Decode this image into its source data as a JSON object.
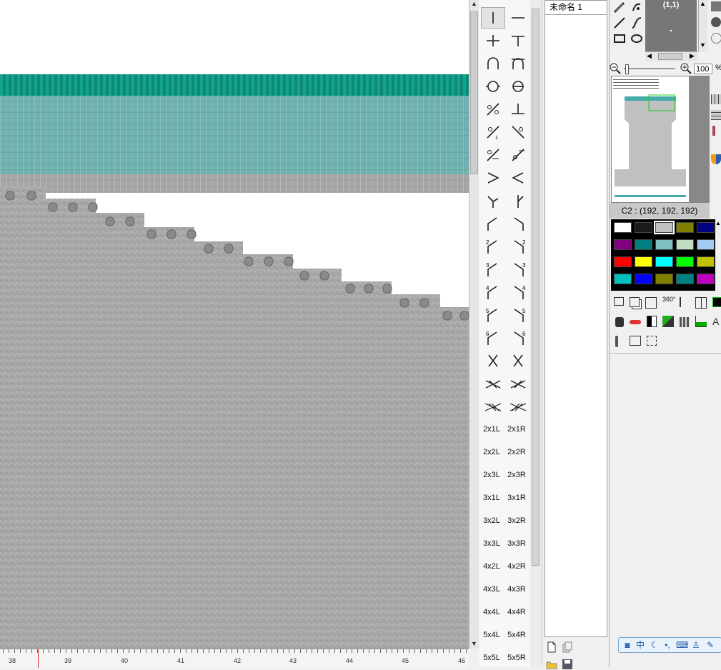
{
  "document": {
    "tab_title": "未命名 1"
  },
  "canvas": {
    "ruler": {
      "labels": [
        "38",
        "39",
        "40",
        "41",
        "42",
        "43",
        "44",
        "45",
        "46"
      ]
    }
  },
  "palette": {
    "symbols": [
      "vertical-line",
      "horizontal-line",
      "plus",
      "t-shape",
      "arch-open",
      "arch-closed",
      "circle-horizontal",
      "circle-vertical",
      "slash-circles",
      "inverted-t",
      "transfer-left",
      "transfer-right",
      "cross-left",
      "cross-right",
      "chevron-right",
      "chevron-left",
      "y-left",
      "y-right",
      "bend-left",
      "bend-right",
      "bend-left-2",
      "bend-right-2",
      "bend-left-3",
      "bend-right-3",
      "bend-left-4",
      "bend-right-4",
      "bend-left-5",
      "bend-right-5",
      "bend-left-6",
      "bend-right-6",
      "x-cross",
      "x-cross-mirror",
      "double-cross",
      "double-cross-mirror",
      "triple-cross",
      "triple-cross-mirror"
    ],
    "text_items": [
      "2x1L",
      "2x1R",
      "2x2L",
      "2x2R",
      "2x3L",
      "2x3R",
      "3x1L",
      "3x1R",
      "3x2L",
      "3x2R",
      "3x3L",
      "3x3R",
      "4x2L",
      "4x2R",
      "4x3L",
      "4x3R",
      "4x4L",
      "4x4R",
      "5x4L",
      "5x4R",
      "5x5L",
      "5x5R"
    ]
  },
  "navigator": {
    "coordinate": "(1,1)",
    "zoom_value": "100",
    "zoom_unit": "%"
  },
  "color": {
    "label": "C2 : (192, 192, 192)",
    "swatches": [
      "#ffffff",
      "#1a1a1a",
      "#c0c0c0",
      "#808000",
      "#000080",
      "#800080",
      "#008080",
      "#7fbfbf",
      "#c0dcc0",
      "#a6caf0",
      "#ff0000",
      "#ffff00",
      "#00ffff",
      "#00ff00",
      "#c0c000",
      "#00c0c0",
      "#0000ff",
      "#808000",
      "#008080",
      "#c000c0"
    ],
    "selected_index": 2
  },
  "ime": {
    "mode": "中"
  }
}
